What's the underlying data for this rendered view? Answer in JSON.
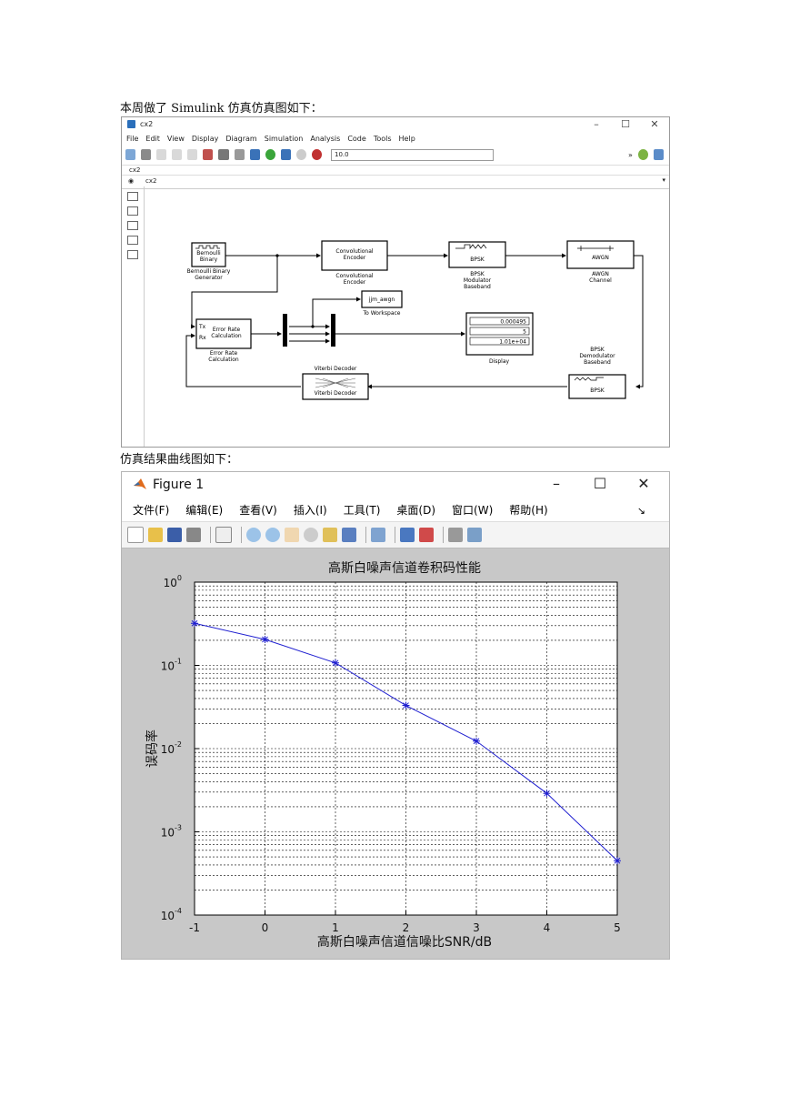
{
  "intro_text": "本周做了 Simulink 仿真仿真图如下：",
  "result_text": "仿真结果曲线图如下：",
  "simulink": {
    "window_title": "cx2",
    "menu": [
      "File",
      "Edit",
      "View",
      "Display",
      "Diagram",
      "Simulation",
      "Analysis",
      "Code",
      "Tools",
      "Help"
    ],
    "sim_time": "10.0",
    "tab": "cx2",
    "breadcrumb": "cx2",
    "blocks": {
      "bernoulli_icon": "Bernoulli\nBinary",
      "bernoulli_label": "Bernoulli Binary\nGenerator",
      "conv_icon": "Convolutional\nEncoder",
      "conv_label": "Convolutional\nEncoder",
      "bpsk_mod_icon": "BPSK",
      "bpsk_mod_label": "BPSK\nModulator\nBaseband",
      "awgn_icon": "AWGN",
      "awgn_label": "AWGN\nChannel",
      "workspace_icon": "jjm_awgn",
      "workspace_label": "To Workspace",
      "error_icon": "Error Rate\nCalculation",
      "error_label": "Error Rate\nCalculation",
      "error_tx": "Tx",
      "error_rx": "Rx",
      "display_values": [
        "0.000495",
        "5",
        "1.01e+04"
      ],
      "display_label": "Display",
      "bpsk_demod_icon": "BPSK",
      "bpsk_demod_label": "BPSK\nDemodulator\nBaseband",
      "viterbi_icon": "Viterbi Decoder",
      "viterbi_label": "Viterbi Decoder"
    }
  },
  "figure": {
    "window_title": "Figure 1",
    "menu": [
      "文件(F)",
      "编辑(E)",
      "查看(V)",
      "插入(I)",
      "工具(T)",
      "桌面(D)",
      "窗口(W)",
      "帮助(H)"
    ],
    "colors": {
      "line": "#1f1fd0",
      "axes_bg": "#ffffff",
      "figure_bg": "#c8c8c8"
    }
  },
  "chart_data": {
    "type": "line",
    "title": "高斯白噪声信道卷积码性能",
    "xlabel": "高斯白噪声信道信噪比SNR/dB",
    "ylabel": "误码率",
    "xlim": [
      -1,
      5
    ],
    "ylim": [
      0.0001,
      1
    ],
    "yscale": "log",
    "grid": true,
    "x_ticks": [
      "-1",
      "0",
      "1",
      "2",
      "3",
      "4",
      "5"
    ],
    "y_ticks": [
      {
        "base": "10",
        "exp": "0",
        "value": 1
      },
      {
        "base": "10",
        "exp": "-1",
        "value": 0.1
      },
      {
        "base": "10",
        "exp": "-2",
        "value": 0.01
      },
      {
        "base": "10",
        "exp": "-3",
        "value": 0.001
      },
      {
        "base": "10",
        "exp": "-4",
        "value": 0.0001
      }
    ],
    "series": [
      {
        "x": [
          -1,
          0,
          1,
          2,
          3,
          4,
          5
        ],
        "y": [
          0.32,
          0.205,
          0.107,
          0.033,
          0.0123,
          0.0029,
          0.00045
        ],
        "marker": "*"
      }
    ]
  }
}
